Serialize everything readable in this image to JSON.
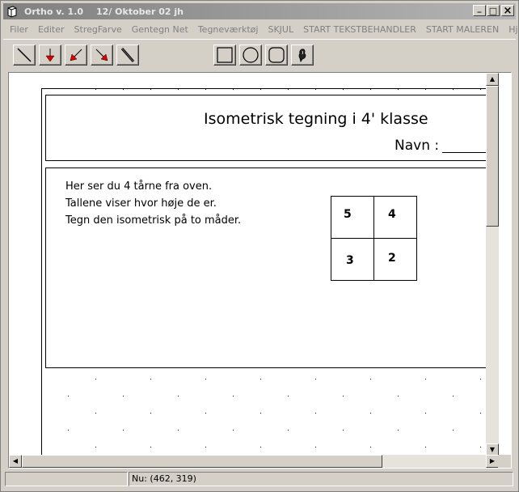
{
  "window": {
    "title": "Ortho v. 1.0",
    "subtitle": "12/ Oktober 02 jh",
    "controls": {
      "minimize": "_",
      "maximize": "□",
      "close": "×"
    }
  },
  "menu": [
    "Filer",
    "Editer",
    "StregFarve",
    "Gentegn Net",
    "Tegneværktøj",
    "SKJUL",
    "START TEKSTBEHANDLER",
    "START MALEREN",
    "Hjælp"
  ],
  "toolbar": {
    "tools": [
      {
        "icon": "line-tool-icon"
      },
      {
        "icon": "red-arrow-down-icon"
      },
      {
        "icon": "red-arrow-down-left-icon"
      },
      {
        "icon": "red-arrow-down-right-icon"
      },
      {
        "icon": "pen-tool-icon"
      },
      {
        "icon": "rectangle-tool-icon"
      },
      {
        "icon": "circle-tool-icon"
      },
      {
        "icon": "rounded-rect-tool-icon"
      },
      {
        "icon": "spray-tool-icon"
      }
    ],
    "accent_color": "#e00000"
  },
  "document": {
    "title": "Isometrisk tegning i 4' klasse",
    "name_label": "Navn :",
    "instructions": [
      "Her ser du 4 tårne fra oven.",
      "Tallene viser hvor høje de er.",
      "Tegn den isometrisk på to måder."
    ],
    "tower_heights": {
      "top_left": "5",
      "top_right": "4",
      "bottom_left": "3",
      "bottom_right": "2"
    }
  },
  "statusbar": {
    "coords": "Nu: (462, 319)"
  }
}
